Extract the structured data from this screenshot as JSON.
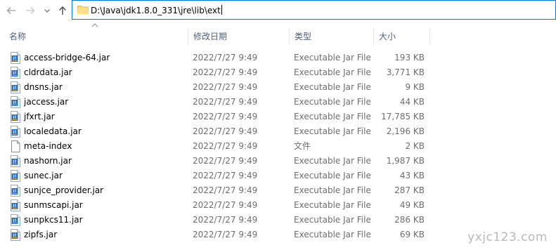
{
  "window": {
    "address_path": "D:\\Java\\jdk1.8.0_331\\jre\\lib\\ext"
  },
  "columns": {
    "name": "名称",
    "date": "修改日期",
    "type": "类型",
    "size": "大小"
  },
  "files": [
    {
      "name": "access-bridge-64.jar",
      "date": "2022/7/27 9:49",
      "type": "Executable Jar File",
      "size": "193 KB",
      "icon": "jar-icon"
    },
    {
      "name": "cldrdata.jar",
      "date": "2022/7/27 9:49",
      "type": "Executable Jar File",
      "size": "3,771 KB",
      "icon": "jar-icon"
    },
    {
      "name": "dnsns.jar",
      "date": "2022/7/27 9:49",
      "type": "Executable Jar File",
      "size": "9 KB",
      "icon": "jar-icon"
    },
    {
      "name": "jaccess.jar",
      "date": "2022/7/27 9:49",
      "type": "Executable Jar File",
      "size": "44 KB",
      "icon": "jar-icon"
    },
    {
      "name": "jfxrt.jar",
      "date": "2022/7/27 9:49",
      "type": "Executable Jar File",
      "size": "17,785 KB",
      "icon": "jar-icon"
    },
    {
      "name": "localedata.jar",
      "date": "2022/7/27 9:49",
      "type": "Executable Jar File",
      "size": "2,196 KB",
      "icon": "jar-icon"
    },
    {
      "name": "meta-index",
      "date": "2022/7/27 9:49",
      "type": "文件",
      "size": "2 KB",
      "icon": "blank-file-icon"
    },
    {
      "name": "nashorn.jar",
      "date": "2022/7/27 9:49",
      "type": "Executable Jar File",
      "size": "1,987 KB",
      "icon": "jar-icon"
    },
    {
      "name": "sunec.jar",
      "date": "2022/7/27 9:49",
      "type": "Executable Jar File",
      "size": "43 KB",
      "icon": "jar-icon"
    },
    {
      "name": "sunjce_provider.jar",
      "date": "2022/7/27 9:49",
      "type": "Executable Jar File",
      "size": "287 KB",
      "icon": "jar-icon"
    },
    {
      "name": "sunmscapi.jar",
      "date": "2022/7/27 9:49",
      "type": "Executable Jar File",
      "size": "49 KB",
      "icon": "jar-icon"
    },
    {
      "name": "sunpkcs11.jar",
      "date": "2022/7/27 9:49",
      "type": "Executable Jar File",
      "size": "286 KB",
      "icon": "jar-icon"
    },
    {
      "name": "zipfs.jar",
      "date": "2022/7/27 9:49",
      "type": "Executable Jar File",
      "size": "69 KB",
      "icon": "jar-icon"
    }
  ],
  "watermark": "yxjc123.com",
  "colors": {
    "address_border": "#0078d7",
    "folder": "#f8d775",
    "header_text": "#4c607a",
    "detail_text": "#6d6d6d",
    "watermark": "#b9b9b9"
  }
}
